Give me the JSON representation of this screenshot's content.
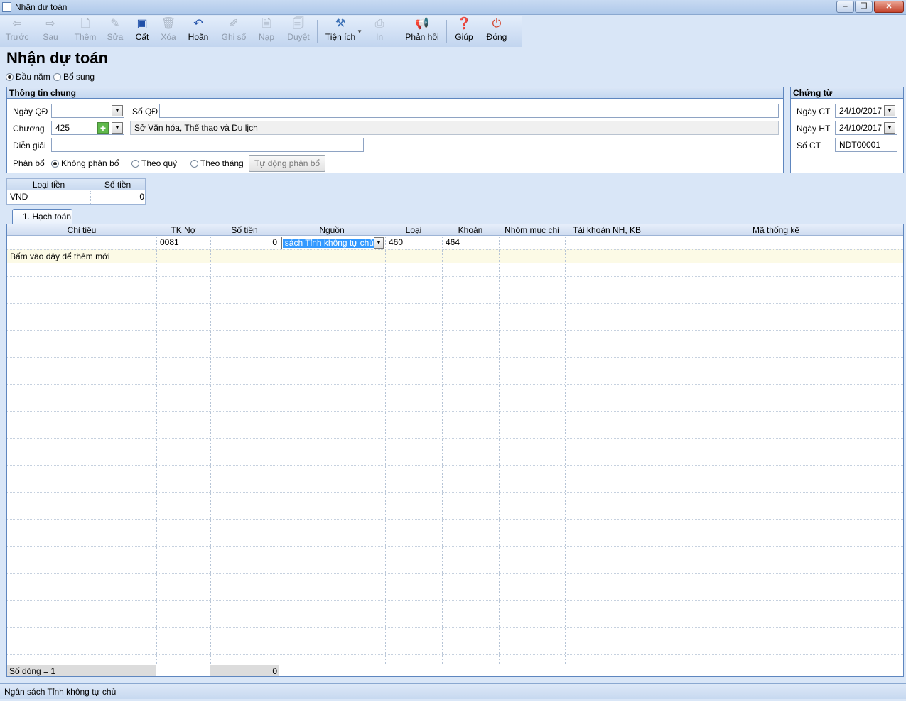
{
  "window": {
    "title": "Nhận dự toán"
  },
  "toolbar": {
    "prev": "Trước",
    "next": "Sau",
    "add": "Thêm",
    "edit": "Sửa",
    "save": "Cất",
    "delete": "Xóa",
    "undo": "Hoãn",
    "post": "Ghi sổ",
    "load": "Nạp",
    "approve": "Duyệt",
    "utilities": "Tiện ích",
    "print": "In",
    "feedback": "Phản hồi",
    "help": "Giúp",
    "close": "Đóng"
  },
  "page": {
    "title": "Nhận dự toán"
  },
  "type_options": {
    "beginning": "Đầu năm",
    "supplement": "Bổ sung",
    "selected": "beginning"
  },
  "general": {
    "title": "Thông tin chung",
    "decision_date_label": "Ngày QĐ",
    "decision_date": "",
    "decision_no_label": "Số QĐ",
    "decision_no": "",
    "chapter_label": "Chương",
    "chapter_code": "425",
    "chapter_name": "Sở Văn hóa, Thể thao và Du lịch",
    "description_label": "Diễn giải",
    "description": "",
    "allocation_label": "Phân bổ",
    "alloc_none": "Không phân bổ",
    "alloc_quarter": "Theo quý",
    "alloc_month": "Theo tháng",
    "auto_allocate": "Tự động phân bổ"
  },
  "voucher": {
    "title": "Chứng từ",
    "voucher_date_label": "Ngày CT",
    "voucher_date": "24/10/2017",
    "posting_date_label": "Ngày HT",
    "posting_date": "24/10/2017",
    "voucher_no_label": "Số CT",
    "voucher_no": "NDT00001"
  },
  "currency_table": {
    "col_type": "Loại tiền",
    "col_amount": "Số tiền",
    "type": "VND",
    "amount": "0"
  },
  "tab": {
    "label": "1. Hạch toán"
  },
  "grid": {
    "columns": [
      "Chỉ tiêu",
      "TK Nợ",
      "Số tiền",
      "Nguồn",
      "Loại",
      "Khoản",
      "Nhóm mục chi",
      "Tài khoản NH, KB",
      "Mã thống kê"
    ],
    "row": {
      "tk_no": "0081",
      "amount": "0",
      "source": "Ngân sách Tỉnh không tự chủ",
      "loai": "460",
      "khoan": "464"
    },
    "add_new_text": "Bấm vào đây để thêm mới",
    "footer_count": "Số dòng = 1",
    "footer_total": "0"
  },
  "status": {
    "text": "Ngân sách Tỉnh không tự chủ"
  }
}
